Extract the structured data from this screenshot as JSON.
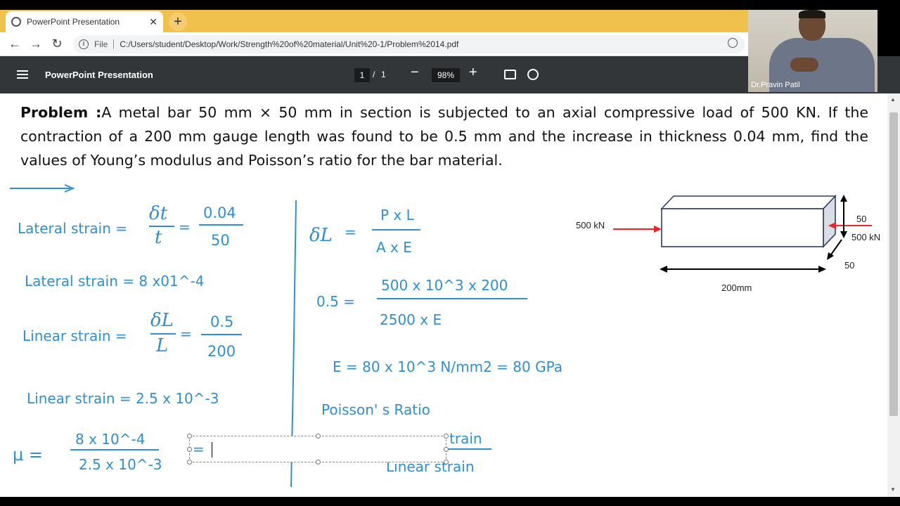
{
  "browser": {
    "tab_title": "PowerPoint Presentation",
    "new_tab_label": "+",
    "file_label": "File",
    "url": "C:/Users/student/Desktop/Work/Strength%20of%20material/Unit%20-1/Problem%2014.pdf"
  },
  "pdf_toolbar": {
    "title": "PowerPoint Presentation",
    "current_page": "1",
    "page_separator": "/",
    "total_pages": "1",
    "zoom": "98%",
    "zoom_out": "−",
    "zoom_in": "+"
  },
  "webcam": {
    "name": "Dr.Pravin Patil"
  },
  "problem": {
    "label": "Problem :",
    "text": "A metal bar 50 mm × 50 mm in section is subjected to an axial compressive load of 500 KN. If the contraction of a 200 mm gauge length was found to be 0.5 mm and the increase in thickness 0.04 mm, find the values of Young’s modulus and Poisson’s ratio for the bar material."
  },
  "notes": {
    "lateral_strain_label": "Lateral strain =",
    "lateral_num_symbol": "δt",
    "lateral_den_symbol": "t",
    "lateral_eq": "=",
    "lateral_num": "0.04",
    "lateral_den": "50",
    "lateral_result": "Lateral strain = 8 x01^-4",
    "linear_strain_label": "Linear strain =",
    "linear_num_symbol": "δL",
    "linear_den_symbol": "L",
    "linear_eq": "=",
    "linear_num": "0.5",
    "linear_den": "200",
    "linear_result": "Linear strain = 2.5 x 10^-3",
    "mu_symbol": "μ =",
    "mu_num": "8 x 10^-4",
    "mu_den": "2.5 x 10^-3",
    "deltaL_symbol": "δL",
    "deltaL_eq": "=",
    "deltaL_num": "P x L",
    "deltaL_den": "A x E",
    "sub_lhs": "0.5 =",
    "sub_num": "500 x 10^3 x 200",
    "sub_den": "2500 x E",
    "e_result": "E = 80 x 10^3 N/mm2 = 80 GPa",
    "poisson_title": "Poisson' s Ratio",
    "poisson_num_tail": "train",
    "poisson_den": "Linear strain",
    "textbox_text": "="
  },
  "figure": {
    "load_left": "500 kN",
    "load_right": "500 kN",
    "dim_height": "50",
    "dim_depth": "50",
    "dim_length": "200mm",
    "arrow_color": "#e8262b"
  },
  "colors": {
    "ink": "#2f8fd1",
    "toolbar": "#323639",
    "tabbar": "#f0c14b"
  }
}
